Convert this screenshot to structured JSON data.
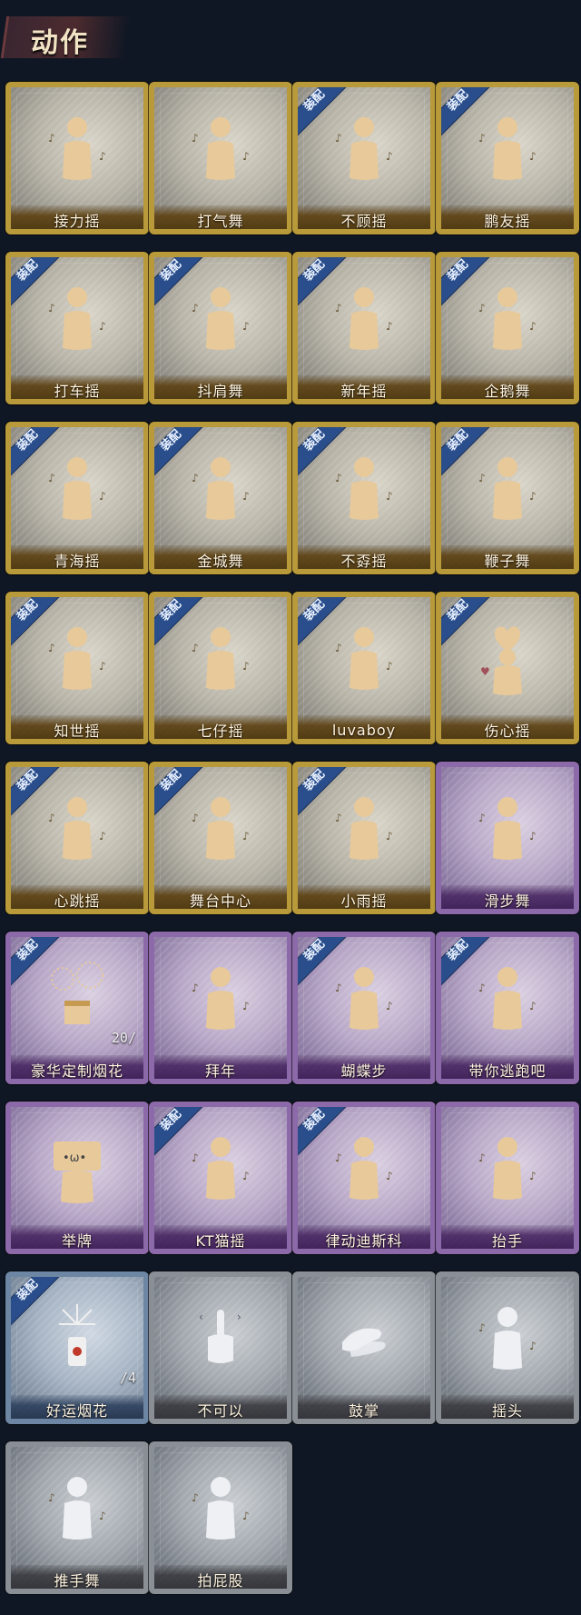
{
  "header": {
    "title": "动作"
  },
  "badge_text": "装配",
  "cards": [
    {
      "label": "接力摇",
      "tier": "gold",
      "equipped": false,
      "icon": "person-dance-icon"
    },
    {
      "label": "打气舞",
      "tier": "gold",
      "equipped": false,
      "icon": "person-dance-icon"
    },
    {
      "label": "不顾摇",
      "tier": "gold",
      "equipped": true,
      "icon": "person-dance-icon"
    },
    {
      "label": "鹏友摇",
      "tier": "gold",
      "equipped": true,
      "icon": "person-dance-icon"
    },
    {
      "label": "打车摇",
      "tier": "gold",
      "equipped": true,
      "icon": "person-dance-icon"
    },
    {
      "label": "抖肩舞",
      "tier": "gold",
      "equipped": true,
      "icon": "person-dance-icon"
    },
    {
      "label": "新年摇",
      "tier": "gold",
      "equipped": true,
      "icon": "person-dance-icon"
    },
    {
      "label": "企鹅舞",
      "tier": "gold",
      "equipped": true,
      "icon": "person-dance-icon"
    },
    {
      "label": "青海摇",
      "tier": "gold",
      "equipped": true,
      "icon": "person-dance-icon"
    },
    {
      "label": "金城舞",
      "tier": "gold",
      "equipped": true,
      "icon": "person-dance-icon"
    },
    {
      "label": "不孬摇",
      "tier": "gold",
      "equipped": true,
      "icon": "person-dance-icon"
    },
    {
      "label": "鞭子舞",
      "tier": "gold",
      "equipped": true,
      "icon": "person-dance-icon"
    },
    {
      "label": "知世摇",
      "tier": "gold",
      "equipped": true,
      "icon": "person-dance-icon"
    },
    {
      "label": "七仔摇",
      "tier": "gold",
      "equipped": true,
      "icon": "person-dance-icon"
    },
    {
      "label": "luvaboy",
      "tier": "gold",
      "equipped": true,
      "icon": "person-dance-icon"
    },
    {
      "label": "伤心摇",
      "tier": "gold",
      "equipped": true,
      "icon": "heart-hands-icon"
    },
    {
      "label": "心跳摇",
      "tier": "gold",
      "equipped": true,
      "icon": "person-dance-icon"
    },
    {
      "label": "舞台中心",
      "tier": "gold",
      "equipped": true,
      "icon": "person-dance-icon"
    },
    {
      "label": "小雨摇",
      "tier": "gold",
      "equipped": true,
      "icon": "person-dance-icon"
    },
    {
      "label": "滑步舞",
      "tier": "purple",
      "equipped": false,
      "icon": "person-dance-icon"
    },
    {
      "label": "豪华定制烟花",
      "tier": "purple",
      "equipped": true,
      "icon": "fireworks-box-icon",
      "count": "20/"
    },
    {
      "label": "拜年",
      "tier": "purple",
      "equipped": false,
      "icon": "person-bow-icon"
    },
    {
      "label": "蝴蝶步",
      "tier": "purple",
      "equipped": true,
      "icon": "person-point-icon"
    },
    {
      "label": "带你逃跑吧",
      "tier": "purple",
      "equipped": true,
      "icon": "person-point-icon"
    },
    {
      "label": "举牌",
      "tier": "purple",
      "equipped": false,
      "icon": "sign-face-icon"
    },
    {
      "label": "KT猫摇",
      "tier": "purple",
      "equipped": true,
      "icon": "person-dance-icon"
    },
    {
      "label": "律动迪斯科",
      "tier": "purple",
      "equipped": true,
      "icon": "person-disco-icon"
    },
    {
      "label": "抬手",
      "tier": "purple",
      "equipped": false,
      "icon": "person-raise-hand-icon"
    },
    {
      "label": "好运烟花",
      "tier": "blue",
      "equipped": true,
      "icon": "firework-cylinder-icon",
      "count": "/4"
    },
    {
      "label": "不可以",
      "tier": "gray",
      "equipped": false,
      "icon": "finger-wag-icon"
    },
    {
      "label": "鼓掌",
      "tier": "gray",
      "equipped": false,
      "icon": "clapping-hands-icon"
    },
    {
      "label": "摇头",
      "tier": "gray",
      "equipped": false,
      "icon": "head-shake-icon"
    },
    {
      "label": "推手舞",
      "tier": "gray",
      "equipped": false,
      "icon": "person-push-icon"
    },
    {
      "label": "拍屁股",
      "tier": "gray",
      "equipped": false,
      "icon": "person-spank-icon"
    }
  ]
}
